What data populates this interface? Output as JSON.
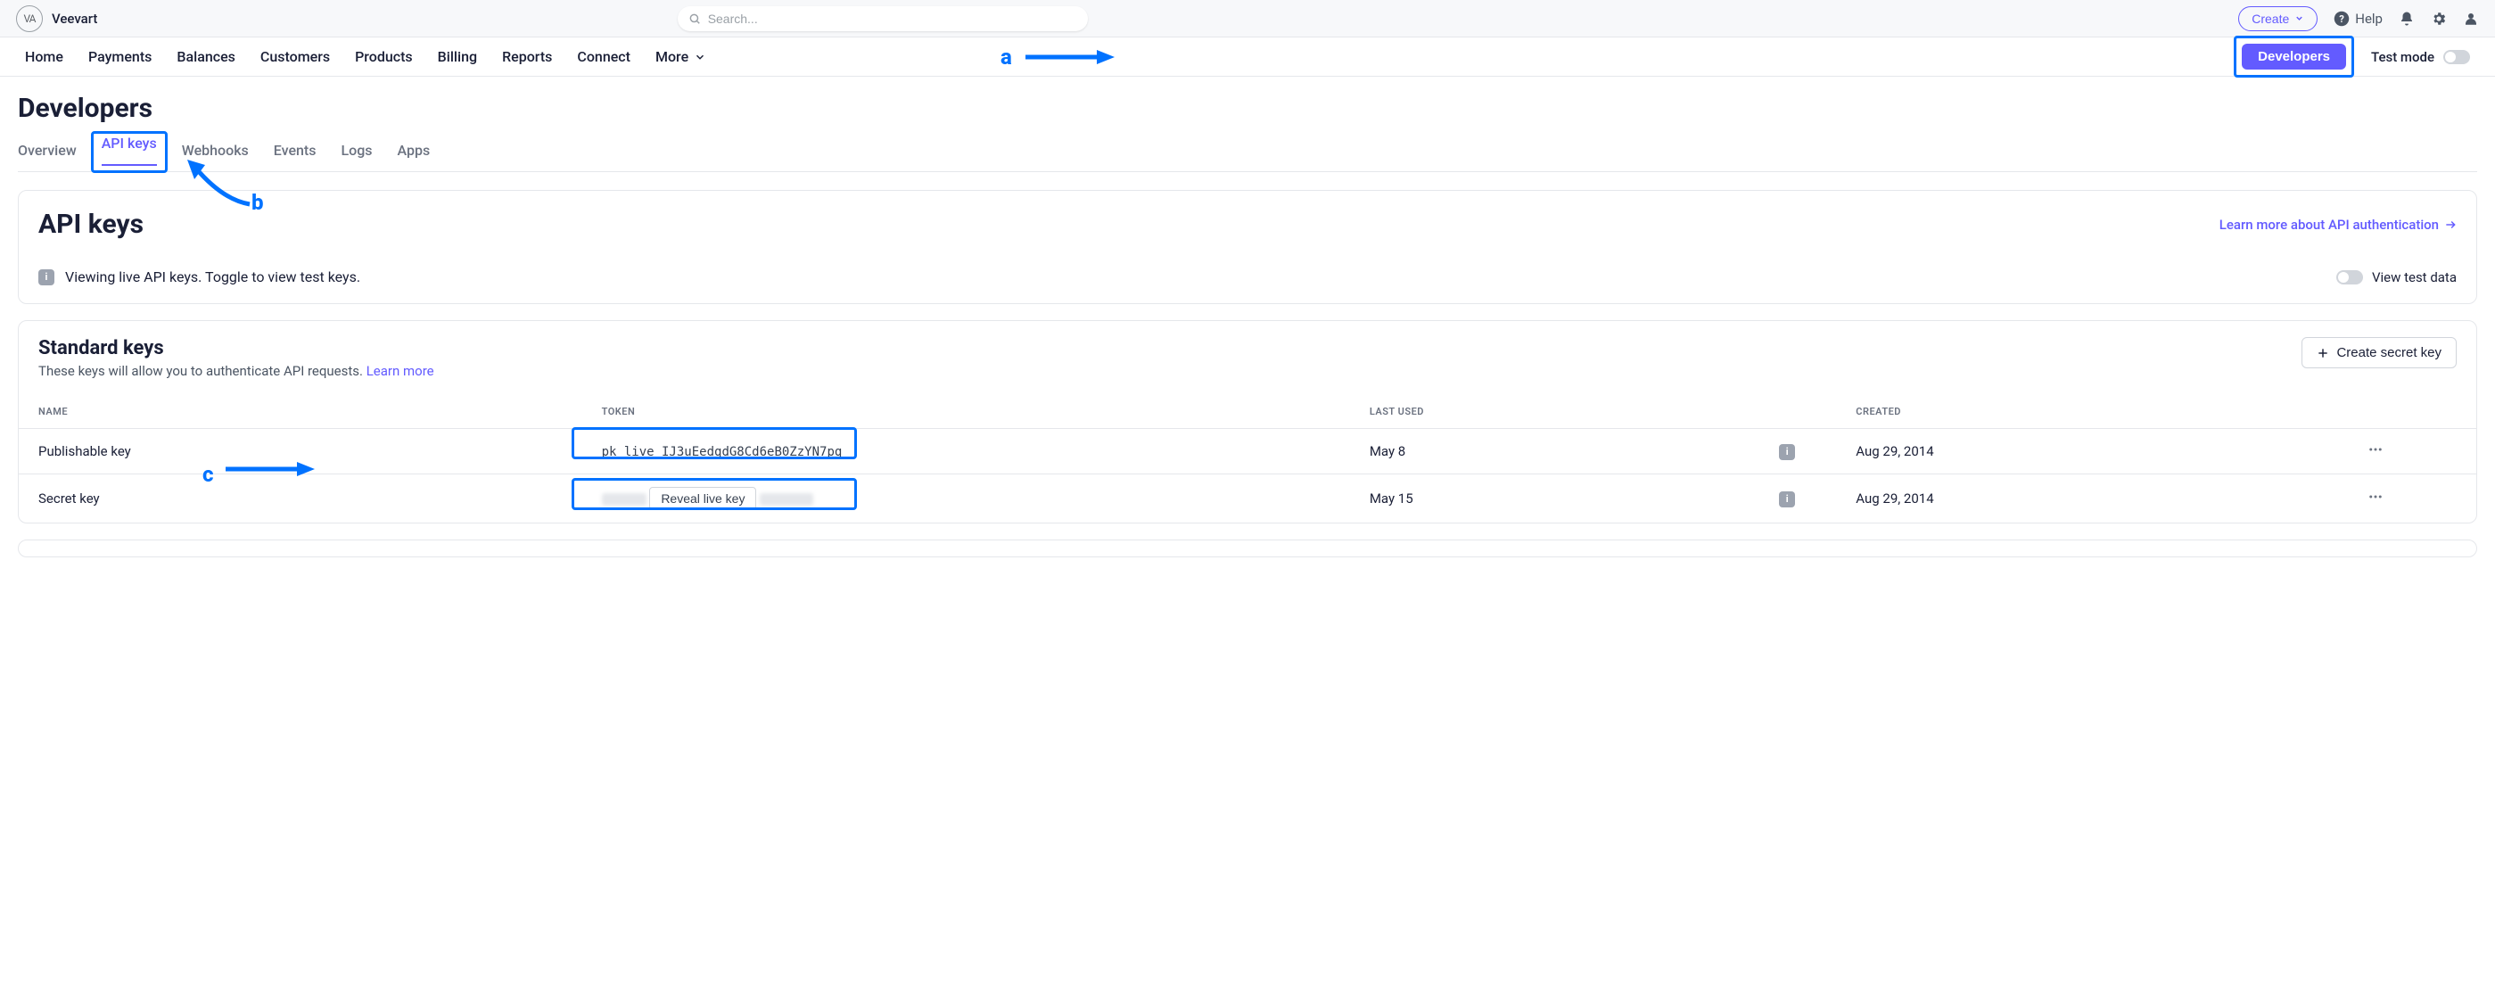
{
  "header": {
    "brand": "Veevart",
    "logo_text": "VA",
    "search_placeholder": "Search...",
    "create_label": "Create",
    "help_label": "Help"
  },
  "nav": {
    "items": [
      "Home",
      "Payments",
      "Balances",
      "Customers",
      "Products",
      "Billing",
      "Reports",
      "Connect",
      "More"
    ],
    "developers_label": "Developers",
    "test_mode_label": "Test mode"
  },
  "page": {
    "title": "Developers",
    "tabs": [
      "Overview",
      "API keys",
      "Webhooks",
      "Events",
      "Logs",
      "Apps"
    ],
    "active_tab_index": 1
  },
  "api_keys_panel": {
    "heading": "API keys",
    "learn_link": "Learn more about API authentication",
    "notice": "Viewing live API keys. Toggle to view test keys.",
    "view_test_label": "View test data"
  },
  "standard_keys": {
    "heading": "Standard keys",
    "subtext": "These keys will allow you to authenticate API requests. ",
    "learn_more": "Learn more",
    "create_secret_label": "Create secret key",
    "columns": [
      "NAME",
      "TOKEN",
      "LAST USED",
      "",
      "CREATED",
      ""
    ],
    "rows": [
      {
        "name": "Publishable key",
        "token": "pk_live_IJ3uEedqdG8Cd6eB0ZzYN7pq",
        "last_used": "May 8",
        "created": "Aug 29, 2014",
        "hidden": false
      },
      {
        "name": "Secret key",
        "token": "",
        "reveal_label": "Reveal live key",
        "last_used": "May 15",
        "created": "Aug 29, 2014",
        "hidden": true
      }
    ]
  },
  "annotations": {
    "a": "a",
    "b": "b",
    "c": "c"
  }
}
